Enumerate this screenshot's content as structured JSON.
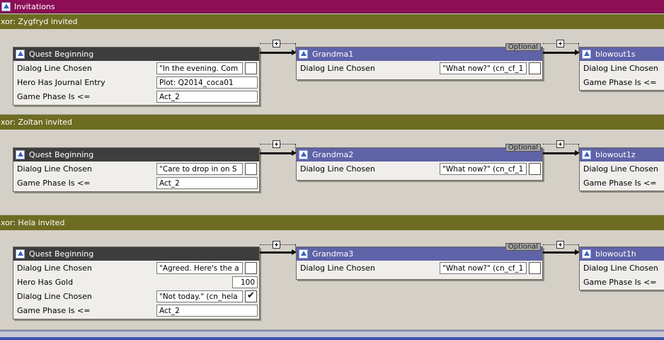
{
  "window": {
    "title": "Invitations",
    "icon": "flow-up-icon"
  },
  "groups": [
    {
      "header": "xor: Zygfryd invited",
      "nodes": [
        {
          "title": "Quest Beginning",
          "optional": "",
          "rows": [
            {
              "label": "Dialog Line Chosen",
              "value": "\"In the evening. Com",
              "checked": false
            },
            {
              "label": "Hero Has Journal Entry",
              "value": "Plot: Q2014_coca01"
            },
            {
              "label": "Game Phase Is <=",
              "value": "Act_2"
            }
          ]
        },
        {
          "title": "Grandma1",
          "optional": "Optional",
          "rows": [
            {
              "label": "Dialog Line Chosen",
              "value": "\"What now?\" (cn_cf_1",
              "checked": false
            }
          ]
        },
        {
          "title": "blowout1s",
          "optional": "",
          "rows": [
            {
              "label": "Dialog Line Chosen",
              "value": ""
            },
            {
              "label": "Game Phase Is <=",
              "value": ""
            }
          ]
        }
      ]
    },
    {
      "header": "xor: Zoltan invited",
      "nodes": [
        {
          "title": "Quest Beginning",
          "optional": "",
          "rows": [
            {
              "label": "Dialog Line Chosen",
              "value": "\"Care to drop in on S",
              "checked": false
            },
            {
              "label": "Game Phase Is <=",
              "value": "Act_2"
            }
          ]
        },
        {
          "title": "Grandma2",
          "optional": "Optional",
          "rows": [
            {
              "label": "Dialog Line Chosen",
              "value": "\"What now?\" (cn_cf_1",
              "checked": false
            }
          ]
        },
        {
          "title": "blowout1z",
          "optional": "",
          "rows": [
            {
              "label": "Dialog Line Chosen",
              "value": ""
            },
            {
              "label": "Game Phase Is <=",
              "value": ""
            }
          ]
        }
      ]
    },
    {
      "header": "xor: Hela invited",
      "nodes": [
        {
          "title": "Quest Beginning",
          "optional": "",
          "rows": [
            {
              "label": "Dialog Line Chosen",
              "value": "\"Agreed. Here's the a",
              "checked": false
            },
            {
              "label": "Hero Has Gold",
              "value": "100"
            },
            {
              "label": "Dialog Line Chosen",
              "value": "\"Not today.\" (cn_hela",
              "checked": true
            },
            {
              "label": "Game Phase Is <=",
              "value": "Act_2"
            }
          ]
        },
        {
          "title": "Grandma3",
          "optional": "Optional",
          "rows": [
            {
              "label": "Dialog Line Chosen",
              "value": "\"What now?\" (cn_cf_1",
              "checked": false
            }
          ]
        },
        {
          "title": "blowout1h",
          "optional": "",
          "rows": [
            {
              "label": "Dialog Line Chosen",
              "value": ""
            },
            {
              "label": "Game Phase Is <=",
              "value": ""
            }
          ]
        }
      ]
    }
  ]
}
